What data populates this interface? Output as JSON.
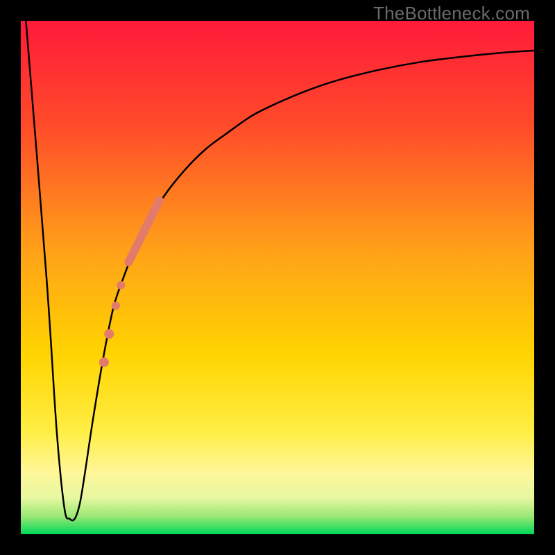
{
  "watermark": "TheBottleneck.com",
  "chart_data": {
    "type": "line",
    "title": "",
    "xlabel": "",
    "ylabel": "",
    "xlim": [
      0,
      100
    ],
    "ylim": [
      0,
      100
    ],
    "gradient_stops": [
      {
        "offset": 0,
        "color": "#ff1a3a"
      },
      {
        "offset": 0.2,
        "color": "#ff4a2a"
      },
      {
        "offset": 0.45,
        "color": "#ffa218"
      },
      {
        "offset": 0.65,
        "color": "#ffd400"
      },
      {
        "offset": 0.8,
        "color": "#ffee44"
      },
      {
        "offset": 0.88,
        "color": "#fff79a"
      },
      {
        "offset": 0.93,
        "color": "#e6f7a0"
      },
      {
        "offset": 0.965,
        "color": "#9be873"
      },
      {
        "offset": 1.0,
        "color": "#00d85a"
      }
    ],
    "series": [
      {
        "name": "bottleneck-curve",
        "x": [
          1,
          5,
          7,
          8.5,
          9.5,
          10.5,
          11.5,
          12.5,
          14,
          16,
          18,
          20,
          22,
          25,
          28,
          32,
          36,
          40,
          45,
          50,
          56,
          62,
          70,
          78,
          86,
          94,
          100
        ],
        "y": [
          100,
          50,
          20,
          5,
          3,
          3,
          6,
          12,
          22,
          34,
          44,
          50,
          55,
          61,
          66,
          71,
          75,
          78,
          81.5,
          84,
          86.5,
          88.5,
          90.5,
          92,
          93,
          93.8,
          94.2
        ]
      }
    ],
    "markers": [
      {
        "name": "salmon-segment-top",
        "type": "thick-line",
        "color": "#e27b6c",
        "p1": {
          "x": 21,
          "y": 53
        },
        "p2": {
          "x": 27,
          "y": 65
        },
        "width": 12
      },
      {
        "name": "salmon-dot-1",
        "type": "dot",
        "color": "#e27b6c",
        "x": 19.5,
        "y": 48.5,
        "r": 6
      },
      {
        "name": "salmon-dot-2",
        "type": "dot",
        "color": "#e27b6c",
        "x": 18.5,
        "y": 44.5,
        "r": 6
      },
      {
        "name": "salmon-dot-3",
        "type": "dot",
        "color": "#e27b6c",
        "x": 17.2,
        "y": 39.0,
        "r": 7
      },
      {
        "name": "salmon-dot-4",
        "type": "dot",
        "color": "#e27b6c",
        "x": 16.2,
        "y": 33.5,
        "r": 7
      }
    ]
  }
}
